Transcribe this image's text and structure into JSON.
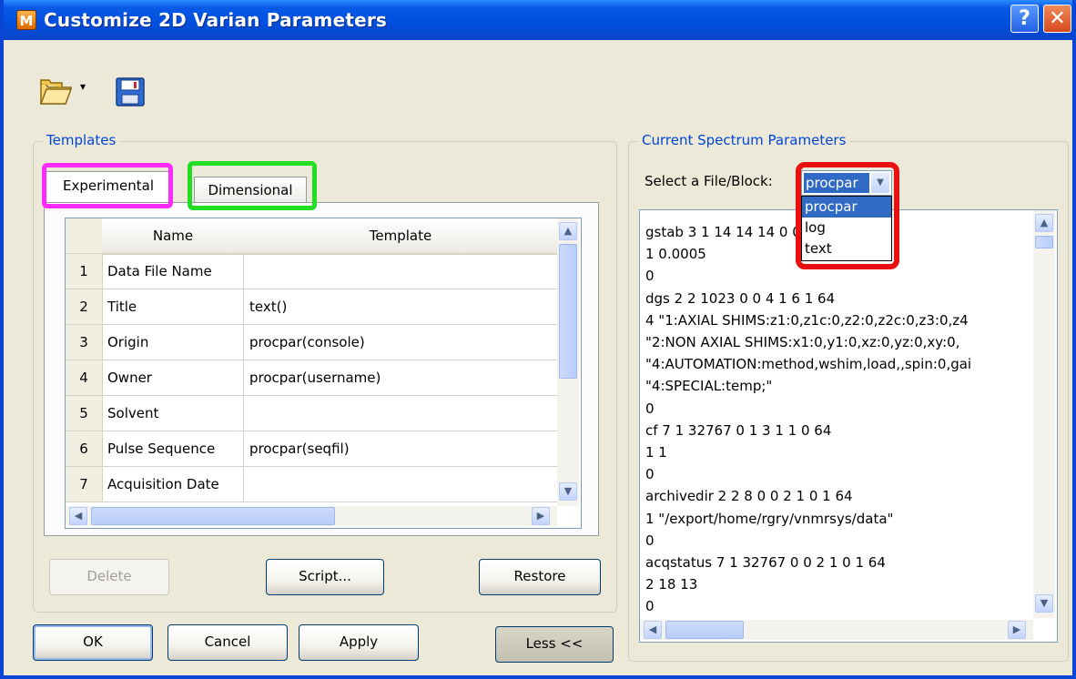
{
  "window": {
    "title": "Customize 2D Varian Parameters",
    "app_icon_letter": "M",
    "help_label": "?",
    "close_label": "✕"
  },
  "toolbar": {
    "open_icon": "folder-open-icon",
    "save_icon": "floppy-disk-icon",
    "dropdown_arrow": "▾"
  },
  "templates": {
    "group_title": "Templates",
    "tabs": [
      {
        "label": "Experimental",
        "active": true
      },
      {
        "label": "Dimensional",
        "active": false
      }
    ],
    "columns": [
      "Name",
      "Template"
    ],
    "rows": [
      {
        "num": "1",
        "name": "Data File Name",
        "template": ""
      },
      {
        "num": "2",
        "name": "Title",
        "template": "text()"
      },
      {
        "num": "3",
        "name": "Origin",
        "template": "procpar(console)"
      },
      {
        "num": "4",
        "name": "Owner",
        "template": "procpar(username)"
      },
      {
        "num": "5",
        "name": "Solvent",
        "template": ""
      },
      {
        "num": "6",
        "name": "Pulse Sequence",
        "template": "procpar(seqfil)"
      },
      {
        "num": "7",
        "name": "Acquisition Date",
        "template": ""
      }
    ],
    "buttons": {
      "delete": "Delete",
      "script": "Script...",
      "restore": "Restore"
    }
  },
  "params": {
    "group_title": "Current Spectrum Parameters",
    "select_label": "Select a File/Block:",
    "selected": "procpar",
    "options": [
      "procpar",
      "log",
      "text"
    ],
    "lines": [
      "gstab 3 1 14 14 14 0 0 1 1 0 64",
      "1 0.0005",
      "0",
      "dgs 2 2 1023 0 0 4 1 6 1 64",
      "4 \"1:AXIAL SHIMS:z1:0,z1c:0,z2:0,z2c:0,z3:0,z4",
      "\"2:NON AXIAL SHIMS:x1:0,y1:0,xz:0,yz:0,xy:0,",
      "\"4:AUTOMATION:method,wshim,load,,spin:0,gai",
      "\"4:SPECIAL:temp;\"",
      "0",
      "cf 7 1 32767 0 1 3 1 1 0 64",
      "1 1",
      "0",
      "archivedir 2 2 8 0 0 2 1 0 1 64",
      "1 \"/export/home/rgry/vnmrsys/data\"",
      "0",
      "acqstatus 7 1 32767 0 0 2 1 0 1 64",
      "2 18 13",
      "0"
    ]
  },
  "footer": {
    "ok": "OK",
    "cancel": "Cancel",
    "apply": "Apply",
    "less": "Less <<"
  },
  "highlights": {
    "experimental_tab": "#ff2aff",
    "dimensional_tab": "#22dd22",
    "file_dropdown": "#e81010"
  },
  "colors": {
    "titlebar": "#0050e0",
    "selection": "#316ac5",
    "group_title": "#0046d5"
  }
}
